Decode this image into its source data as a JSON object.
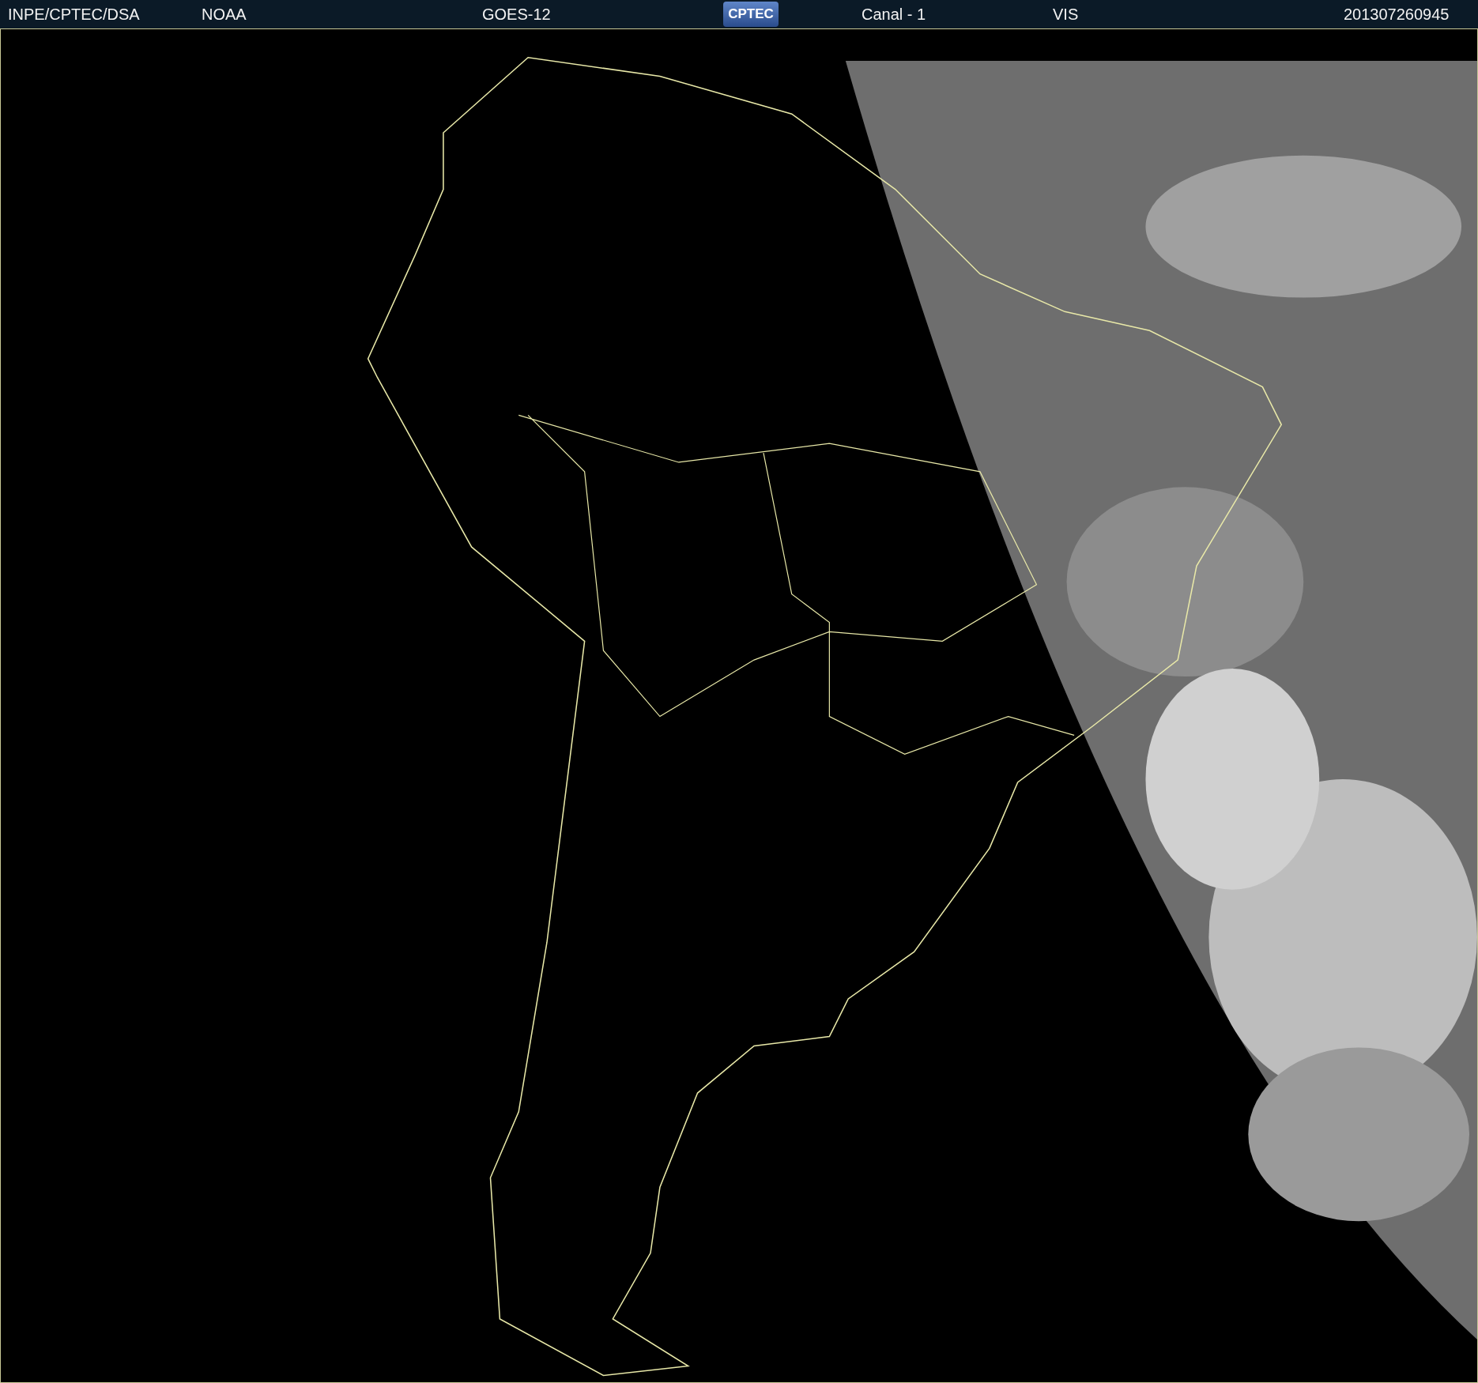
{
  "header": {
    "items": [
      {
        "text": "INPE/CPTEC/DSA",
        "kind": "label"
      },
      {
        "text": "NOAA",
        "kind": "label"
      },
      {
        "text": "GOES-12",
        "kind": "label"
      },
      {
        "text": "CPTEC",
        "kind": "logo"
      },
      {
        "text": "Canal - 1",
        "kind": "label"
      },
      {
        "text": "VIS",
        "kind": "label"
      },
      {
        "text": "201307260945",
        "kind": "label"
      }
    ]
  }
}
